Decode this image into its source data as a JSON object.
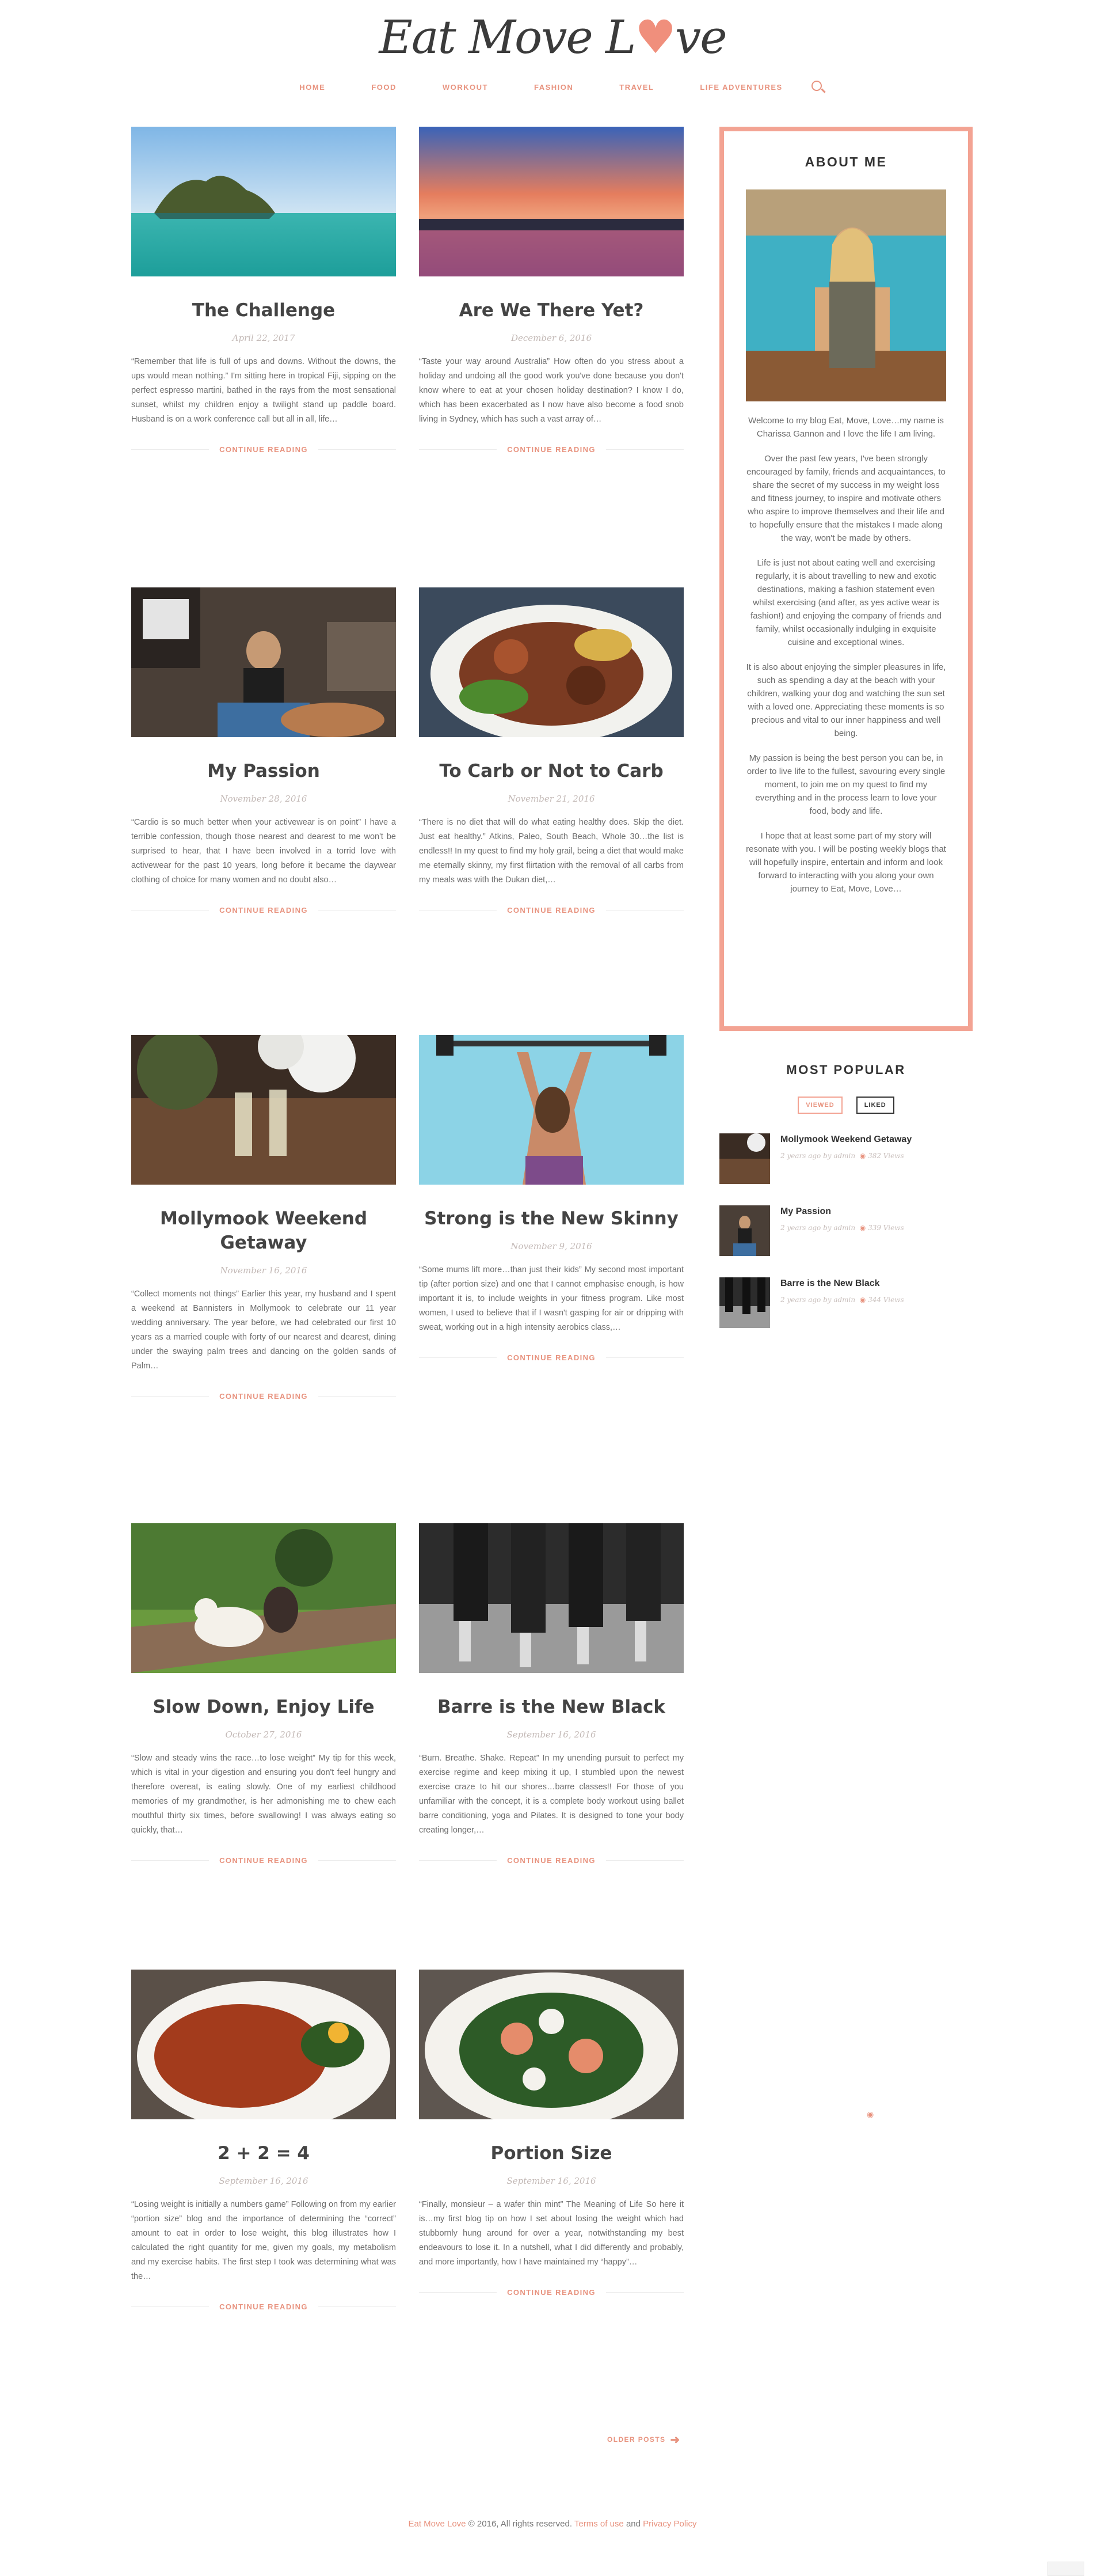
{
  "site": {
    "logo_part1": "Eat Move L",
    "logo_heart": "♥",
    "logo_part2": "ve"
  },
  "nav": {
    "items": [
      "HOME",
      "FOOD",
      "WORKOUT",
      "FASHION",
      "TRAVEL",
      "LIFE ADVENTURES"
    ]
  },
  "posts": [
    {
      "title": "The Challenge",
      "date": "April 22, 2017",
      "excerpt": "“Remember that life is full of ups and downs. Without the downs, the ups would mean nothing.” I'm sitting here in tropical Fiji, sipping on the perfect espresso martini, bathed in the rays from the most sensational sunset, whilst my children enjoy a twilight stand up paddle board. Husband is on a work conference call but all in all, life…",
      "more": "CONTINUE READING"
    },
    {
      "title": "Are We There Yet?",
      "date": "December 6, 2016",
      "excerpt": "“Taste your way around Australia” How often do you stress about a holiday and undoing all the good work you've done because you don't know where to eat at your chosen holiday destination? I know I do, which has been exacerbated as I now have also become a food snob living in Sydney, which has such a vast array of…",
      "more": "CONTINUE READING"
    },
    {
      "title": "My Passion",
      "date": "November 28, 2016",
      "excerpt": "“Cardio is so much better when your activewear is on point” I have a terrible confession, though those nearest and dearest to me won't be surprised to hear, that I have been involved in a torrid love  with activewear for the past 10 years, long before it became the daywear clothing of choice for many women and no doubt also…",
      "more": "CONTINUE READING"
    },
    {
      "title": "To Carb or Not to Carb",
      "date": "November 21, 2016",
      "excerpt": "“There is no diet that will do what eating healthy does. Skip the diet. Just eat healthy.” Atkins, Paleo, South Beach, Whole 30…the list is endless!! In my quest to find my holy grail, being a diet that would make me eternally skinny, my first flirtation with the removal of all carbs from my meals was with the Dukan diet,…",
      "more": "CONTINUE READING"
    },
    {
      "title": "Mollymook Weekend Getaway",
      "date": "November 16, 2016",
      "excerpt": "“Collect moments not things” Earlier this year, my husband and I spent a weekend at Bannisters in Mollymook to celebrate our 11 year wedding anniversary. The year before, we had celebrated our first 10 years as a married couple with forty of our nearest and dearest, dining under the swaying palm trees and dancing on the golden sands of Palm…",
      "more": "CONTINUE READING"
    },
    {
      "title": "Strong is the New Skinny",
      "date": "November 9, 2016",
      "excerpt": "“Some mums lift more…than just their kids” My second most important tip (after portion size) and one that I cannot emphasise enough, is how important it is, to include weights in your fitness program. Like most women, I used to believe that if I wasn't gasping for air or dripping with sweat, working out in a high intensity aerobics class,…",
      "more": "CONTINUE READING"
    },
    {
      "title": "Slow Down, Enjoy Life",
      "date": "October 27, 2016",
      "excerpt": "“Slow and steady wins the race…to lose weight” My tip for this week, which is vital in your digestion and ensuring you don't feel hungry and therefore overeat, is eating slowly. One of my earliest childhood memories of my grandmother, is her admonishing me to chew each mouthful thirty six times, before swallowing! I was always eating so quickly, that…",
      "more": "CONTINUE READING"
    },
    {
      "title": "Barre is the New Black",
      "date": "September 16, 2016",
      "excerpt": "“Burn. Breathe. Shake. Repeat” In my unending pursuit to perfect my exercise regime and keep mixing it up, I stumbled upon the newest exercise craze to hit our shores…barre classes!! For those of you unfamiliar with the concept, it is a complete body workout using ballet barre conditioning, yoga and Pilates. It is designed to tone your body creating longer,…",
      "more": "CONTINUE READING"
    },
    {
      "title": "2 + 2 = 4",
      "date": "September 16, 2016",
      "excerpt": "“Losing weight is initially a numbers game” Following on from my earlier “portion size” blog and the importance of determining the “correct” amount to eat in order to lose weight, this blog illustrates how I calculated the right quantity for me, given my goals, my metabolism and my exercise habits. The first step I took was determining what was the…",
      "more": "CONTINUE READING"
    },
    {
      "title": "Portion Size",
      "date": "September 16, 2016",
      "excerpt": "“Finally, monsieur – a wafer thin mint” The Meaning of Life So here it is…my first blog tip on how I set about losing the weight which had stubbornly hung around for over a year, notwithstanding my best endeavours to lose it. In a nutshell, what I did differently and probably, and more importantly, how I have maintained my “happy”…",
      "more": "CONTINUE READING"
    }
  ],
  "about": {
    "heading": "ABOUT ME",
    "paragraphs": [
      "Welcome to my blog Eat, Move, Love…my name is Charissa Gannon and I love the life I am living.",
      "Over the past few years, I've been strongly encouraged by family, friends and acquaintances, to share the secret of my success in my weight loss and fitness journey, to inspire and motivate others who aspire to improve themselves and their life and to hopefully ensure that the mistakes I made along the way, won't be made by others.",
      "Life is just not about eating well and exercising regularly, it is about travelling to new and exotic destinations, making a fashion statement even whilst exercising (and after, as yes active wear is fashion!) and enjoying the company of friends and family, whilst occasionally indulging in exquisite cuisine and exceptional wines.",
      "It is also about enjoying the simpler pleasures in life, such as spending a day at the beach with your children, walking your dog and watching the sun set with a loved one. Appreciating these moments is so precious and vital to our inner happiness and well being.",
      "My passion is being the best person you can be, in order to live life to the fullest, savouring every single moment, to join me on my quest to find my everything and in the process learn to love your food, body and life.",
      "I hope that at least some part of my story will resonate with you. I will be posting weekly blogs that will hopefully inspire, entertain and inform and look forward to interacting with you along your own journey to Eat, Move, Love…"
    ]
  },
  "popular": {
    "heading": "MOST POPULAR",
    "tabs": [
      "VIEWED",
      "LIKED"
    ],
    "items": [
      {
        "title": "Mollymook Weekend Getaway",
        "meta": "2 years ago  by admin",
        "views": "382 Views"
      },
      {
        "title": "My Passion",
        "meta": "2 years ago  by admin",
        "views": "339 Views"
      },
      {
        "title": "Barre is the New Black",
        "meta": "2 years ago  by admin",
        "views": "344 Views"
      }
    ]
  },
  "pagination": {
    "older": "OLDER POSTS"
  },
  "footer": {
    "brand": "Eat Move Love",
    "copyright": " © 2016, All rights reserved. ",
    "terms": "Terms of use",
    "and": " and ",
    "privacy": "Privacy Policy"
  },
  "colors": {
    "accent": "#e8937f",
    "border": "#f3a393",
    "text": "#6d6d6d",
    "heading": "#444444"
  }
}
